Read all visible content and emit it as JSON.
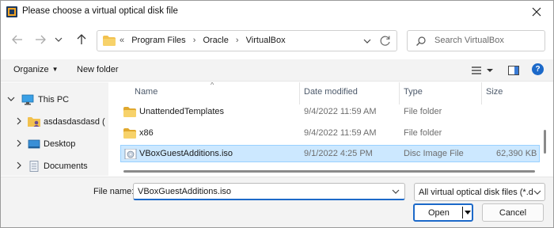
{
  "window": {
    "title": "Please choose a virtual optical disk file",
    "icon": "virtualbox-icon",
    "close_icon": "close-icon"
  },
  "nav": {
    "back_icon": "arrow-left-icon",
    "forward_icon": "arrow-right-icon",
    "recent_icon": "chevron-down-icon",
    "up_icon": "arrow-up-icon"
  },
  "address": {
    "overflow": "«",
    "crumbs": [
      "Program Files",
      "Oracle",
      "VirtualBox"
    ],
    "separator": "›"
  },
  "search": {
    "placeholder": "Search VirtualBox"
  },
  "toolbar": {
    "organize_label": "Organize",
    "new_folder_label": "New folder",
    "help_label": "?"
  },
  "sidebar": {
    "items": [
      {
        "label": "This PC",
        "icon": "computer-icon"
      },
      {
        "label": "asdasdasdasd (",
        "icon": "user-folder-icon"
      },
      {
        "label": "Desktop",
        "icon": "desktop-icon"
      },
      {
        "label": "Documents",
        "icon": "documents-icon"
      }
    ]
  },
  "columns": {
    "name": "Name",
    "date": "Date modified",
    "type": "Type",
    "size": "Size"
  },
  "files": [
    {
      "name": "UnattendedTemplates",
      "date": "9/4/2022 11:59 AM",
      "type": "File folder",
      "size": "",
      "icon": "folder-icon"
    },
    {
      "name": "x86",
      "date": "9/4/2022 11:59 AM",
      "type": "File folder",
      "size": "",
      "icon": "folder-icon"
    },
    {
      "name": "VBoxGuestAdditions.iso",
      "date": "9/1/2022 4:25 PM",
      "type": "Disc Image File",
      "size": "62,390 KB",
      "icon": "disc-image-icon"
    }
  ],
  "footer": {
    "filename_label": "File name:",
    "filename_value": "VBoxGuestAdditions.iso",
    "filter_value": "All virtual optical disk files (*.dr",
    "open_label": "Open",
    "cancel_label": "Cancel"
  },
  "colors": {
    "accent": "#1c69c9",
    "selection_bg": "#cce8ff",
    "selection_border": "#99d1ff",
    "folder": "#f2c14e"
  }
}
